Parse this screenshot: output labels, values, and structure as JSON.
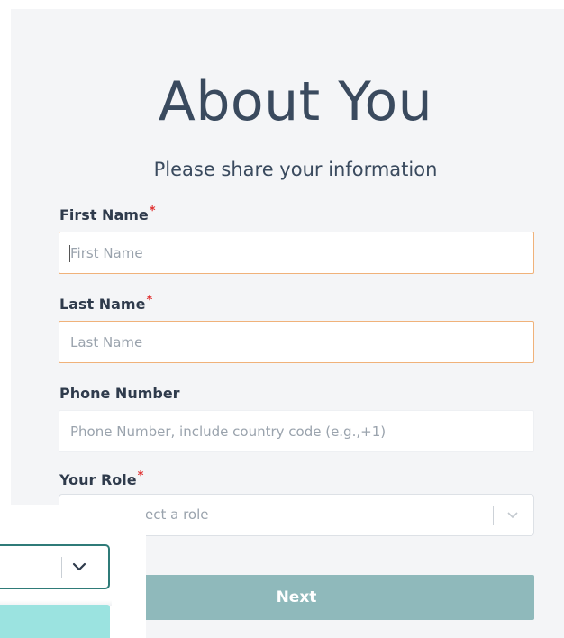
{
  "form": {
    "title": "About You",
    "subtitle": "Please share your information",
    "required_mark": "*",
    "first_name": {
      "label": "First Name",
      "placeholder": "First Name",
      "value": ""
    },
    "last_name": {
      "label": "Last Name",
      "placeholder": "Last Name",
      "value": ""
    },
    "phone": {
      "label": "Phone Number",
      "placeholder": "Phone Number, include country code (e.g.,+1)",
      "value": ""
    },
    "role": {
      "label": "Your Role",
      "placeholder": "ect a role"
    },
    "next_label": "Next"
  },
  "colors": {
    "focus_border": "#f0b27a",
    "required": "#e03131",
    "button": "#8fb9bb",
    "active_select_border": "#2f7b78",
    "highlight_option": "#9be3e0"
  },
  "icons": {
    "select_chevron": "chevron-down-icon"
  }
}
